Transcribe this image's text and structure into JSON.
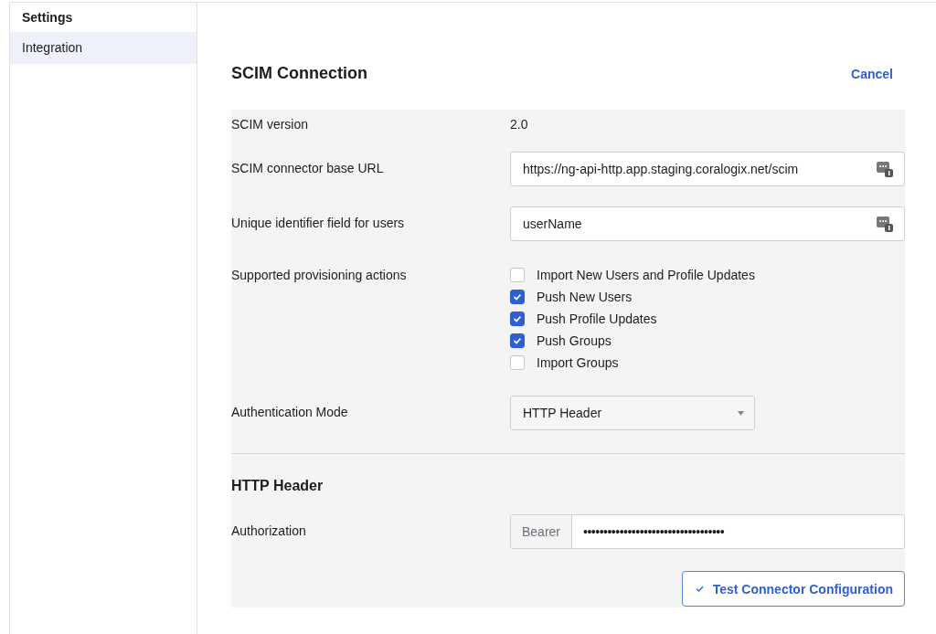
{
  "sidebar": {
    "title": "Settings",
    "items": [
      {
        "label": "Integration",
        "selected": true
      }
    ]
  },
  "header": {
    "title": "SCIM Connection",
    "cancel": "Cancel"
  },
  "version": {
    "label": "SCIM version",
    "value": "2.0"
  },
  "fields": [
    {
      "label": "SCIM connector base URL",
      "value": "https://ng-api-http.app.staging.coralogix.net/scim"
    },
    {
      "label": "Unique identifier field for users",
      "value": "userName"
    }
  ],
  "actions": {
    "label": "Supported provisioning actions",
    "options": [
      {
        "label": "Import New Users and Profile Updates",
        "checked": false
      },
      {
        "label": "Push New Users",
        "checked": true
      },
      {
        "label": "Push Profile Updates",
        "checked": true
      },
      {
        "label": "Push Groups",
        "checked": true
      },
      {
        "label": "Import Groups",
        "checked": false
      }
    ]
  },
  "auth_mode": {
    "label": "Authentication Mode",
    "value": "HTTP Header"
  },
  "http_header": {
    "title": "HTTP Header",
    "label": "Authorization",
    "prefix": "Bearer",
    "value": "•••••••••••••••••••••••••••••••••••"
  },
  "test_button": "Test Connector Configuration"
}
